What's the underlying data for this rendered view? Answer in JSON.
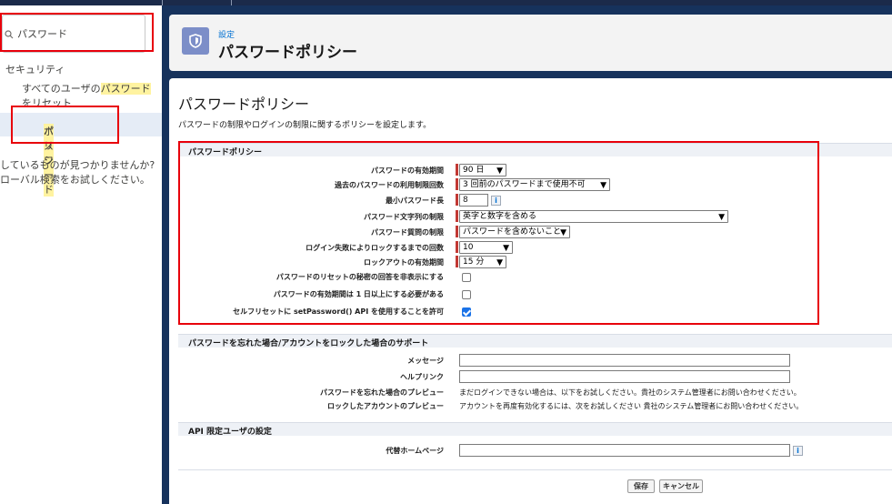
{
  "sidebar": {
    "search_value": "パスワード",
    "section": "セキュリティ",
    "item1_pre": "すべてのユーザの",
    "item1_hl": "パスワード",
    "item1_post": "をリセット",
    "item2_hl": "パスワード",
    "item2_post": "ポリシー",
    "help_line1": "しているものが見つかりませんか?",
    "help_line2": "ローバル検索をお試しください。"
  },
  "header": {
    "breadcrumb": "設定",
    "title": "パスワードポリシー"
  },
  "page": {
    "title": "パスワードポリシー",
    "description": "パスワードの制限やログインの制限に関するポリシーを設定します。"
  },
  "policy": {
    "section_title": "パスワードポリシー",
    "fields": {
      "expiry_label": "パスワードの有効期間",
      "expiry_value": "90 日",
      "history_label": "過去のパスワードの利用制限回数",
      "history_value": "3 回前のパスワードまで使用不可",
      "min_length_label": "最小パスワード長",
      "min_length_value": "8",
      "complexity_label": "パスワード文字列の制限",
      "complexity_value": "英字と数字を含める",
      "question_label": "パスワード質問の制限",
      "question_value": "パスワードを含めないこと",
      "lockout_attempts_label": "ログイン失敗によりロックするまでの回数",
      "lockout_attempts_value": "10",
      "lockout_period_label": "ロックアウトの有効期間",
      "lockout_period_value": "15 分",
      "hide_answer_label": "パスワードのリセットの秘密の回答を非表示にする",
      "min_lifetime_label": "パスワードの有効期間は 1 日以上にする必要がある",
      "setpassword_label": "セルフリセットに setPassword() API を使用することを許可"
    }
  },
  "forgot": {
    "section_title": "パスワードを忘れた場合/アカウントをロックした場合のサポート",
    "message_label": "メッセージ",
    "help_link_label": "ヘルプリンク",
    "forgot_preview_label": "パスワードを忘れた場合のプレビュー",
    "forgot_preview_value": "まだログインできない場合は、以下をお試しください。貴社のシステム管理者にお問い合わせください。",
    "locked_preview_label": "ロックしたアカウントのプレビュー",
    "locked_preview_value": "アカウントを再度有効化するには、次をお試しください 貴社のシステム管理者にお問い合わせください。"
  },
  "api": {
    "section_title": "API 限定ユーザの設定",
    "alt_home_label": "代替ホームページ"
  },
  "buttons": {
    "save": "保存",
    "cancel": "キャンセル"
  },
  "colors": {
    "frame": "#16325c",
    "highlight": "#fff3a0",
    "annotation": "#e8000b",
    "required": "#c23934",
    "checkbox_on": "#1a73e8"
  }
}
